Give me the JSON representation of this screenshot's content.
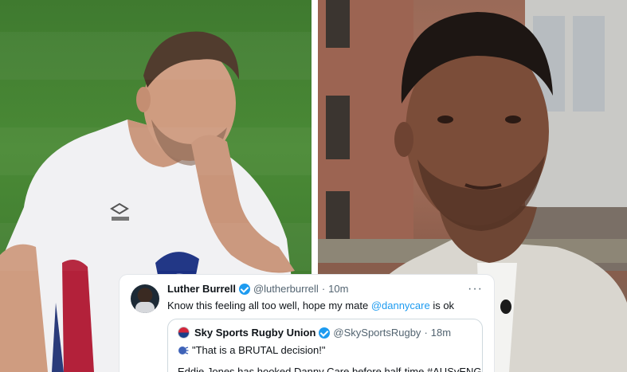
{
  "tweet": {
    "author_name": "Luther Burrell",
    "author_handle": "@lutherburrell",
    "time": "10m",
    "more_label": "···",
    "text_before": "Know this feeling all too well, hope my mate ",
    "mention": "@dannycare",
    "text_after": " is ok",
    "quote": {
      "author_name": "Sky Sports Rugby Union",
      "author_handle": "@SkySportsRugby",
      "time": "18m",
      "line1": "\"That is a BRUTAL decision!\"",
      "line2": "Eddie Jones has hooked Danny Care before half-time #AUSvENG"
    }
  },
  "photos": {
    "left": "rugby-player-white-shirt",
    "right": "man-interview-street"
  },
  "colors": {
    "verified": "#1d9bf0",
    "link": "#1d9bf0",
    "pitch_green": "#4a8a36",
    "brick": "#a9735e"
  }
}
